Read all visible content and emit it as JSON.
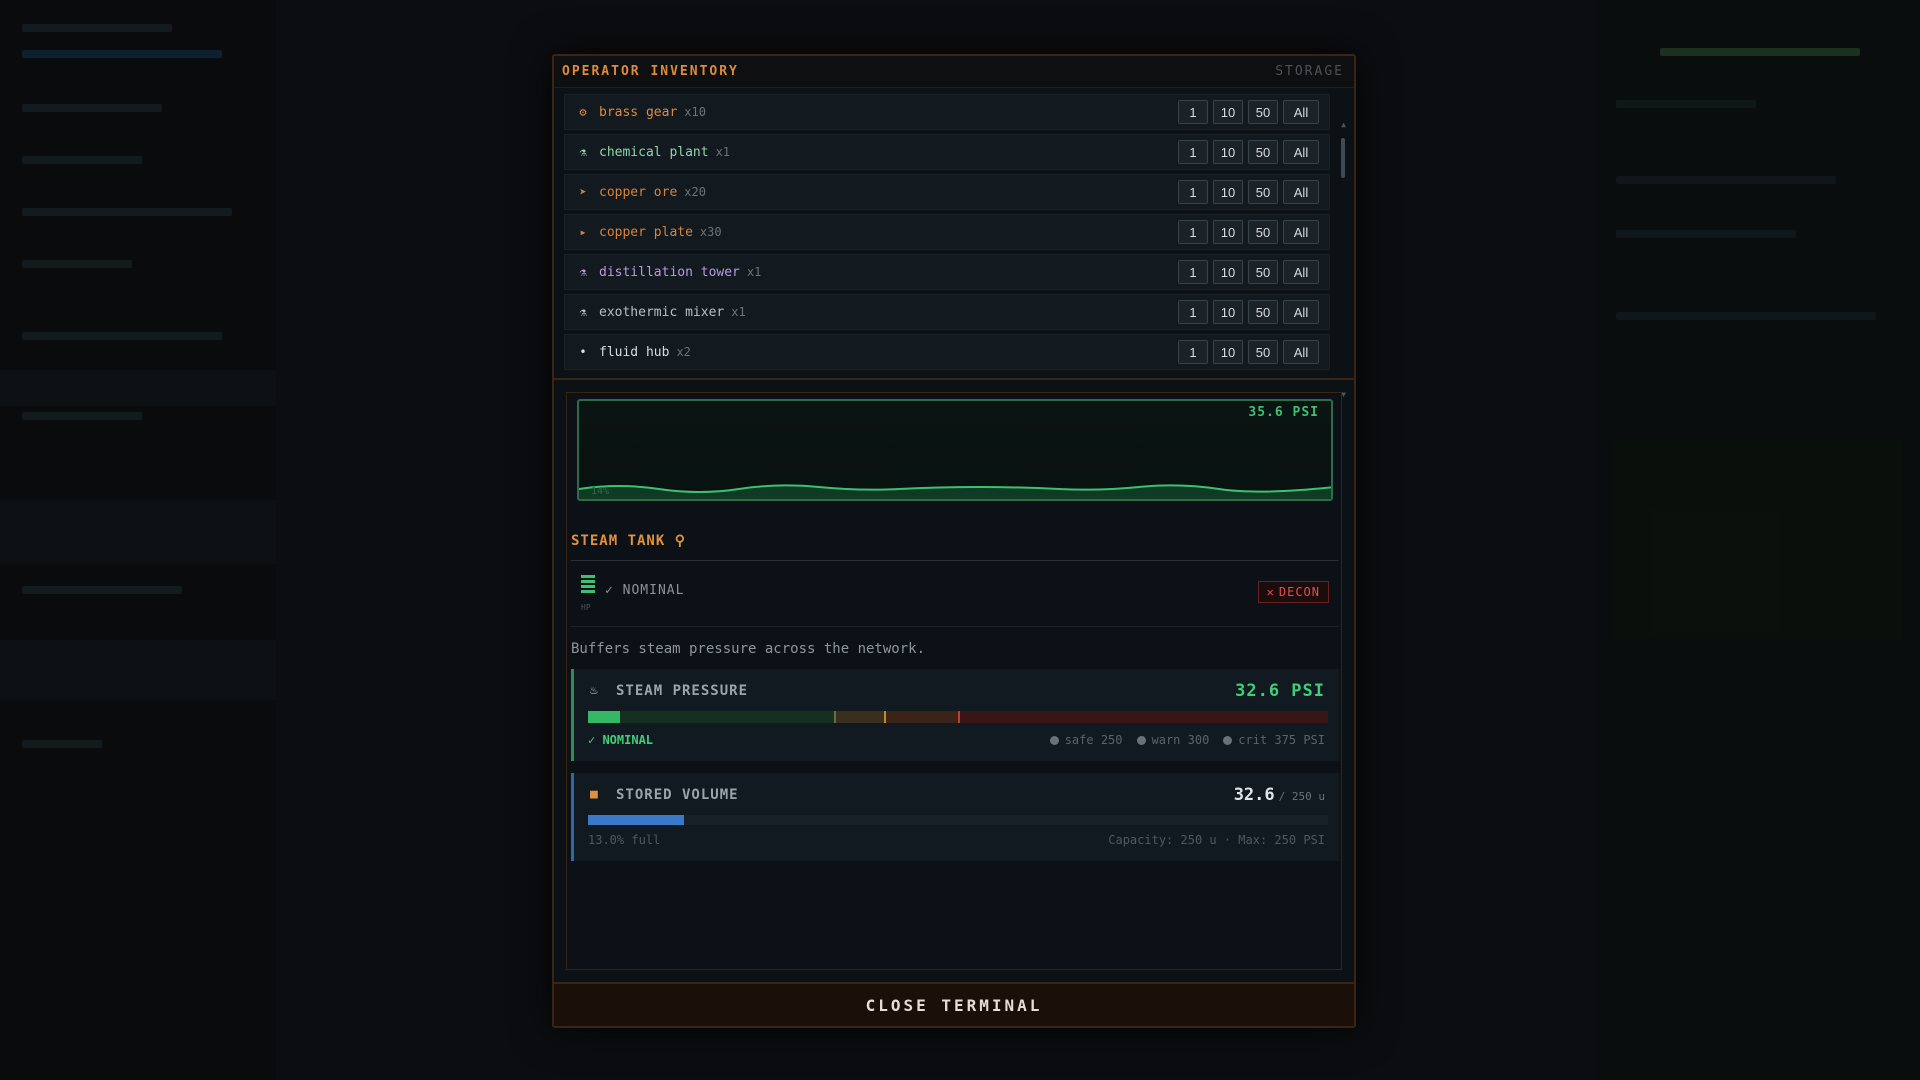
{
  "inventory": {
    "title": "OPERATOR INVENTORY",
    "subtitle": "STORAGE",
    "buttons": [
      "1",
      "10",
      "50",
      "All"
    ],
    "items": [
      {
        "icon": "gear-icon",
        "glyph": "⚙",
        "color": "#e08a3c",
        "name": "brass gear",
        "qty": "x10"
      },
      {
        "icon": "flask-icon",
        "glyph": "⚗",
        "color": "#8fd6a8",
        "name": "chemical plant",
        "qty": "x1"
      },
      {
        "icon": "ore-arrow-icon",
        "glyph": "➤",
        "color": "#d7823c",
        "name": "copper ore",
        "qty": "x20"
      },
      {
        "icon": "play-icon",
        "glyph": "▸",
        "color": "#d7823c",
        "name": "copper plate",
        "qty": "x30"
      },
      {
        "icon": "flask-icon",
        "glyph": "⚗",
        "color": "#b89be0",
        "name": "distillation tower",
        "qty": "x1"
      },
      {
        "icon": "flask-icon",
        "glyph": "⚗",
        "color": "#b8bfc4",
        "name": "exothermic mixer",
        "qty": "x1"
      },
      {
        "icon": "dot-icon",
        "glyph": "•",
        "color": "#d8dde0",
        "name": "fluid hub",
        "qty": "x2"
      }
    ]
  },
  "graph": {
    "value_label": "35.6 PSI",
    "min_label": "14%"
  },
  "tank": {
    "title": "STEAM TANK ⚲",
    "hp_label": "HP",
    "status": "✓ NOMINAL",
    "decon_label": "DECON",
    "description": "Buffers steam pressure across the network."
  },
  "pressure": {
    "title": "STEAM PRESSURE",
    "value": "32.6 PSI",
    "fraction": 0.0435,
    "status": "✓ NOMINAL",
    "legend": [
      "safe 250",
      "warn 300",
      "crit 375 PSI"
    ]
  },
  "volume": {
    "title": "STORED VOLUME",
    "value": "32.6",
    "unit": "/ 250 u",
    "fraction": 0.13,
    "pct_label": "13.0% full",
    "capacity_label": "Capacity: 250 u  ·  Max: 250 PSI"
  },
  "close_label": "CLOSE TERMINAL",
  "colors": {
    "accent": "#e08a3c",
    "good": "#3fcf7a",
    "danger": "#e05050",
    "volume": "#3a78c8"
  }
}
